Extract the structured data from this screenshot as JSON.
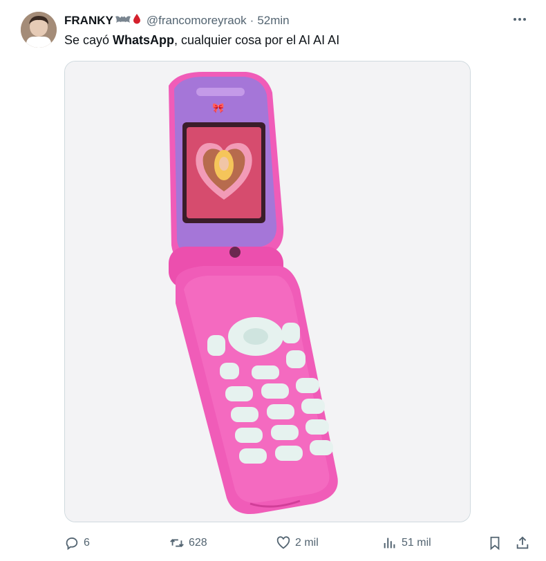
{
  "tweet": {
    "author_name": "FRANKY",
    "author_handle": "@francomoreyraok",
    "separator": "·",
    "time": "52min",
    "text_before": "Se cayó ",
    "text_bold": "WhatsApp",
    "text_after": ", cualquier cosa por el AI AI AI",
    "name_emojis": [
      "bat-icon",
      "blood-drop-icon"
    ]
  },
  "media": {
    "alt": "Pink flip phone",
    "colors": {
      "phone_pink": "#f05cb8",
      "phone_purple": "#a576d8",
      "keypad_white": "#e9f3f1"
    }
  },
  "actions": {
    "replies": "6",
    "retweets": "628",
    "likes": "2 mil",
    "views": "51 mil"
  },
  "icons": [
    "more-icon",
    "reply-icon",
    "retweet-icon",
    "like-icon",
    "views-icon",
    "bookmark-icon",
    "share-icon"
  ]
}
